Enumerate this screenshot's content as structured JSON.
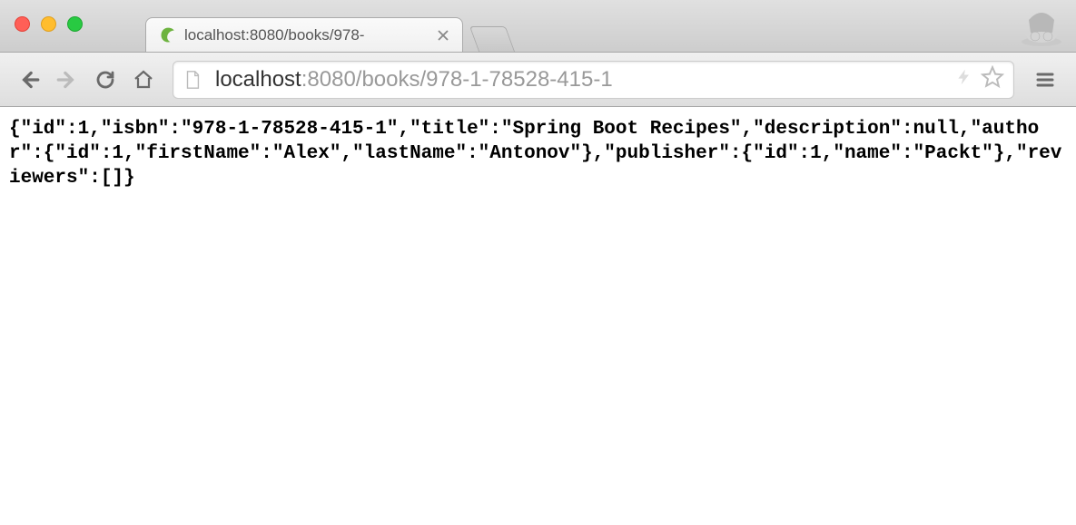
{
  "window": {
    "tab_title": "localhost:8080/books/978-",
    "url_host": "localhost",
    "url_path": ":8080/books/978-1-78528-415-1"
  },
  "response": {
    "raw": "{\"id\":1,\"isbn\":\"978-1-78528-415-1\",\"title\":\"Spring Boot Recipes\",\"description\":null,\"author\":{\"id\":1,\"firstName\":\"Alex\",\"lastName\":\"Antonov\"},\"publisher\":{\"id\":1,\"name\":\"Packt\"},\"reviewers\":[]}",
    "json": {
      "id": 1,
      "isbn": "978-1-78528-415-1",
      "title": "Spring Boot Recipes",
      "description": null,
      "author": {
        "id": 1,
        "firstName": "Alex",
        "lastName": "Antonov"
      },
      "publisher": {
        "id": 1,
        "name": "Packt"
      },
      "reviewers": []
    }
  }
}
